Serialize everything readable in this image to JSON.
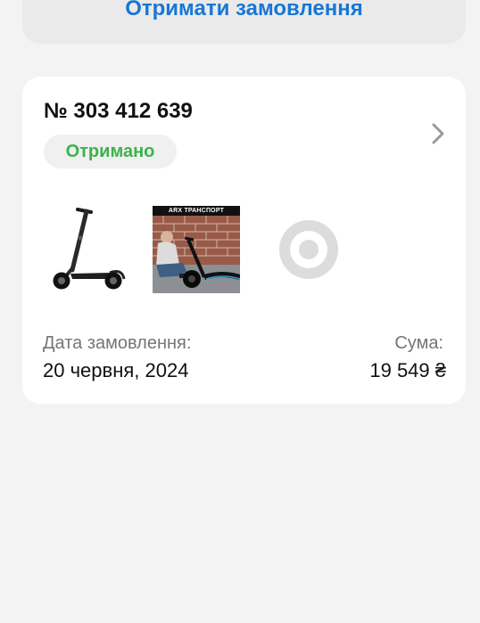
{
  "top_action": {
    "label": "Отримати замовлення"
  },
  "order": {
    "number": "№ 303 412 639",
    "status": "Отримано",
    "thumbnails": [
      {
        "icon": "electric-scooter-image"
      },
      {
        "icon": "scooter-promo-image",
        "banner": "ARX ТРАНСПОРТ"
      },
      {
        "icon": "target-placeholder-icon"
      }
    ],
    "date_label": "Дата замовлення:",
    "date_value": "20 червня, 2024",
    "sum_label": "Сума:",
    "sum_value": "19 549 ₴"
  },
  "colors": {
    "accent": "#1877d6",
    "status_green": "#3cb24d",
    "background": "#f3f3f3",
    "card": "#ffffff",
    "muted_text": "#757575"
  }
}
